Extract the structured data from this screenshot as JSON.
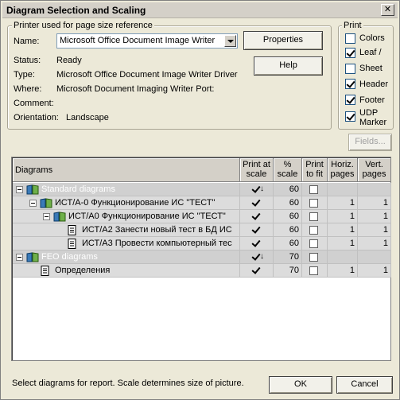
{
  "window": {
    "title": "Diagram Selection and Scaling",
    "close_glyph": "✕"
  },
  "printer_group": {
    "legend": "Printer used for page size reference",
    "name_label": "Name:",
    "name_value": "Microsoft Office Document Image Writer",
    "properties_button": "Properties",
    "help_button": "Help",
    "status_label": "Status:",
    "status_value": "Ready",
    "type_label": "Type:",
    "type_value": "Microsoft Office Document Image Writer Driver",
    "where_label": "Where:",
    "where_value": "Microsoft Document Imaging Writer Port:",
    "comment_label": "Comment:",
    "comment_value": "",
    "orientation_label": "Orientation:",
    "orientation_value": "Landscape"
  },
  "print_group": {
    "legend": "Print",
    "options": [
      {
        "label": "Colors",
        "checked": false
      },
      {
        "label": "Leaf /",
        "checked": true
      },
      {
        "label": "Sheet",
        "checked": false
      },
      {
        "label": "Header",
        "checked": true
      },
      {
        "label": "Footer",
        "checked": true
      },
      {
        "label": "UDP Marker",
        "checked": true
      }
    ],
    "fields_button": "Fields..."
  },
  "grid": {
    "columns": [
      "Diagrams",
      "Print at scale",
      "% scale",
      "Print to fit",
      "Horiz. pages",
      "Vert. pages"
    ],
    "rows": [
      {
        "name": "Standard diagrams",
        "level": 0,
        "type": "group",
        "print_at_scale": true,
        "scale": "60",
        "fit": false,
        "horiz": "",
        "vert": ""
      },
      {
        "name": "ИСТ/А-0 Функционирование ИС \"ТЕСТ\"",
        "level": 1,
        "type": "folder",
        "print_at_scale": true,
        "scale": "60",
        "fit": false,
        "horiz": "1",
        "vert": "1"
      },
      {
        "name": "ИСТ/А0 Функционирование ИС \"ТЕСТ\"",
        "level": 2,
        "type": "folder",
        "print_at_scale": true,
        "scale": "60",
        "fit": false,
        "horiz": "1",
        "vert": "1"
      },
      {
        "name": "ИСТ/А2 Занести новый тест в БД ИС",
        "level": 3,
        "type": "doc",
        "print_at_scale": true,
        "scale": "60",
        "fit": false,
        "horiz": "1",
        "vert": "1"
      },
      {
        "name": "ИСТ/А3 Провести компьютерный тес",
        "level": 3,
        "type": "doc",
        "print_at_scale": true,
        "scale": "60",
        "fit": false,
        "horiz": "1",
        "vert": "1"
      },
      {
        "name": "FEO diagrams",
        "level": 0,
        "type": "group",
        "print_at_scale": true,
        "scale": "70",
        "fit": false,
        "horiz": "",
        "vert": ""
      },
      {
        "name": "Определения",
        "level": 1,
        "type": "doc",
        "print_at_scale": true,
        "scale": "70",
        "fit": false,
        "horiz": "1",
        "vert": "1"
      }
    ]
  },
  "footer": {
    "status_text": "Select diagrams for report. Scale determines size of picture.",
    "ok_button": "OK",
    "cancel_button": "Cancel"
  }
}
